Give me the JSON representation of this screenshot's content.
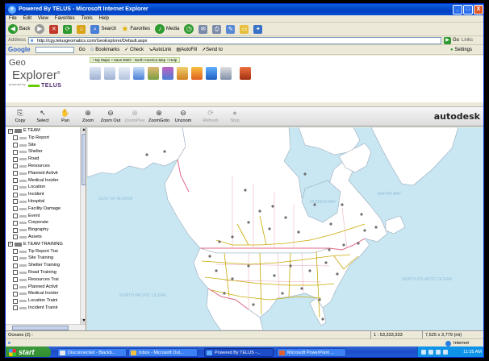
{
  "window": {
    "title": "Powered By TELUS - Microsoft Internet Explorer",
    "buttons": [
      "_",
      "□",
      "X"
    ]
  },
  "menu": [
    "File",
    "Edit",
    "View",
    "Favorites",
    "Tools",
    "Help"
  ],
  "nav": {
    "back": "Back",
    "search": "Search",
    "favorites": "Favorites",
    "media": "Media"
  },
  "address": {
    "label": "Address",
    "url": "http://cgy.telusgeomatics.com/GeoExplorer/Default.aspx",
    "go": "Go",
    "links": "Links"
  },
  "google": {
    "logo": "Google",
    "go_label": "Go",
    "bookmarks": "Bookmarks",
    "check": "Check",
    "autolink": "AutoLink",
    "autofill": "AutoFill",
    "sendto": "Send to",
    "settings": "Settings"
  },
  "app": {
    "logo_geo": "Geo",
    "logo_explorer": "Explorer",
    "logo_powered": "powered by",
    "logo_telus": "TELUS",
    "sitelinks": [
      "My Maps",
      "Save EMO - North America Map",
      "Help"
    ],
    "autodesk": "autodesk",
    "viewtools": [
      {
        "label": "Copy",
        "icon": "⎘",
        "disabled": false
      },
      {
        "label": "Select",
        "icon": "↖",
        "disabled": false
      },
      {
        "label": "Pan",
        "icon": "✋",
        "disabled": false
      },
      {
        "label": "Zoom",
        "icon": "⊕",
        "disabled": false
      },
      {
        "label": "Zoom Out",
        "icon": "⊖",
        "disabled": false
      },
      {
        "label": "ZoomPrev",
        "icon": "⊕",
        "disabled": true
      },
      {
        "label": "ZoomGoto",
        "icon": "⊕",
        "disabled": false
      },
      {
        "label": "Unzoom",
        "icon": "⊖",
        "disabled": false
      },
      {
        "label": "Refresh",
        "icon": "⟳",
        "disabled": true
      },
      {
        "label": "Stop",
        "icon": "●",
        "disabled": true
      }
    ]
  },
  "layers": [
    {
      "label": "E TEAM",
      "group": true,
      "checked": true
    },
    {
      "label": "Tip Report",
      "group": false,
      "checked": false
    },
    {
      "label": "Site",
      "group": false,
      "checked": false
    },
    {
      "label": "Shelter",
      "group": false,
      "checked": false
    },
    {
      "label": "Road",
      "group": false,
      "checked": false
    },
    {
      "label": "Resources",
      "group": false,
      "checked": false
    },
    {
      "label": "Planned Activit",
      "group": false,
      "checked": false
    },
    {
      "label": "Medical Incider",
      "group": false,
      "checked": false
    },
    {
      "label": "Location",
      "group": false,
      "checked": false
    },
    {
      "label": "Incident",
      "group": false,
      "checked": false
    },
    {
      "label": "Hospital",
      "group": false,
      "checked": false
    },
    {
      "label": "Facility Damage",
      "group": false,
      "checked": false
    },
    {
      "label": "Event",
      "group": false,
      "checked": false
    },
    {
      "label": "Corporate",
      "group": false,
      "checked": false
    },
    {
      "label": "Biography",
      "group": false,
      "checked": false
    },
    {
      "label": "Assets",
      "group": false,
      "checked": false
    },
    {
      "label": "E TEAM TRAINING",
      "group": true,
      "checked": true
    },
    {
      "label": "Tip Report Trai",
      "group": false,
      "checked": false
    },
    {
      "label": "Site Training",
      "group": false,
      "checked": false
    },
    {
      "label": "Shelter Training",
      "group": false,
      "checked": false
    },
    {
      "label": "Road Training",
      "group": false,
      "checked": false
    },
    {
      "label": "Resources Trai",
      "group": false,
      "checked": false
    },
    {
      "label": "Planned Activit",
      "group": false,
      "checked": false
    },
    {
      "label": "Medical Incider",
      "group": false,
      "checked": false
    },
    {
      "label": "Location Traini",
      "group": false,
      "checked": false
    },
    {
      "label": "Incident Trainir",
      "group": false,
      "checked": false
    }
  ],
  "map": {
    "ocean_labels": [
      "GULF OF ALASKA",
      "BAFFIN BAY",
      "NORTH ATLANTIC OCEAN",
      "NORTH PACIFIC OCEAN",
      "HUDSON BAY"
    ],
    "colors": {
      "water": "#c9e7f3",
      "land": "#ffffff",
      "border": "#e06a8a",
      "road": "#c7a900"
    }
  },
  "status": {
    "left": "Oceans (2) :",
    "scale": "1 : 53,333,333",
    "dims": "7,525 x 3,779 (mi)"
  },
  "iestatus": {
    "zone": "Internet"
  },
  "taskbar": {
    "start": "start",
    "items": [
      {
        "label": "Disconnected - Blackb...",
        "color": "#e8e8e8",
        "active": false
      },
      {
        "label": "Inbox - Microsoft Out...",
        "color": "#f0c040",
        "active": false
      },
      {
        "label": "Powered By TELUS -...",
        "color": "#5aa9ff",
        "active": true
      },
      {
        "label": "Microsoft PowerPoint ...",
        "color": "#e06030",
        "active": false
      }
    ],
    "clock": "11:35 AM"
  }
}
